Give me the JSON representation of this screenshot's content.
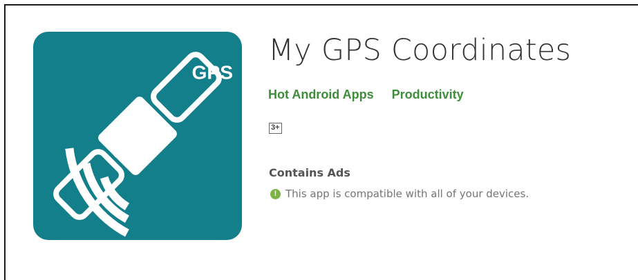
{
  "app": {
    "title": "My GPS Coordinates",
    "developer": "Hot Android Apps",
    "category": "Productivity",
    "content_rating": "3+",
    "ads_label": "Contains Ads",
    "compatibility": "This app is compatible with all of your devices.",
    "icon": {
      "name": "satellite-gps-icon",
      "label": "GPS",
      "background": "#137f8b",
      "foreground": "#ffffff"
    }
  },
  "colors": {
    "title": "#333333",
    "link": "#3d8d3a",
    "muted": "#757575",
    "compat_icon": "#7cb342"
  }
}
